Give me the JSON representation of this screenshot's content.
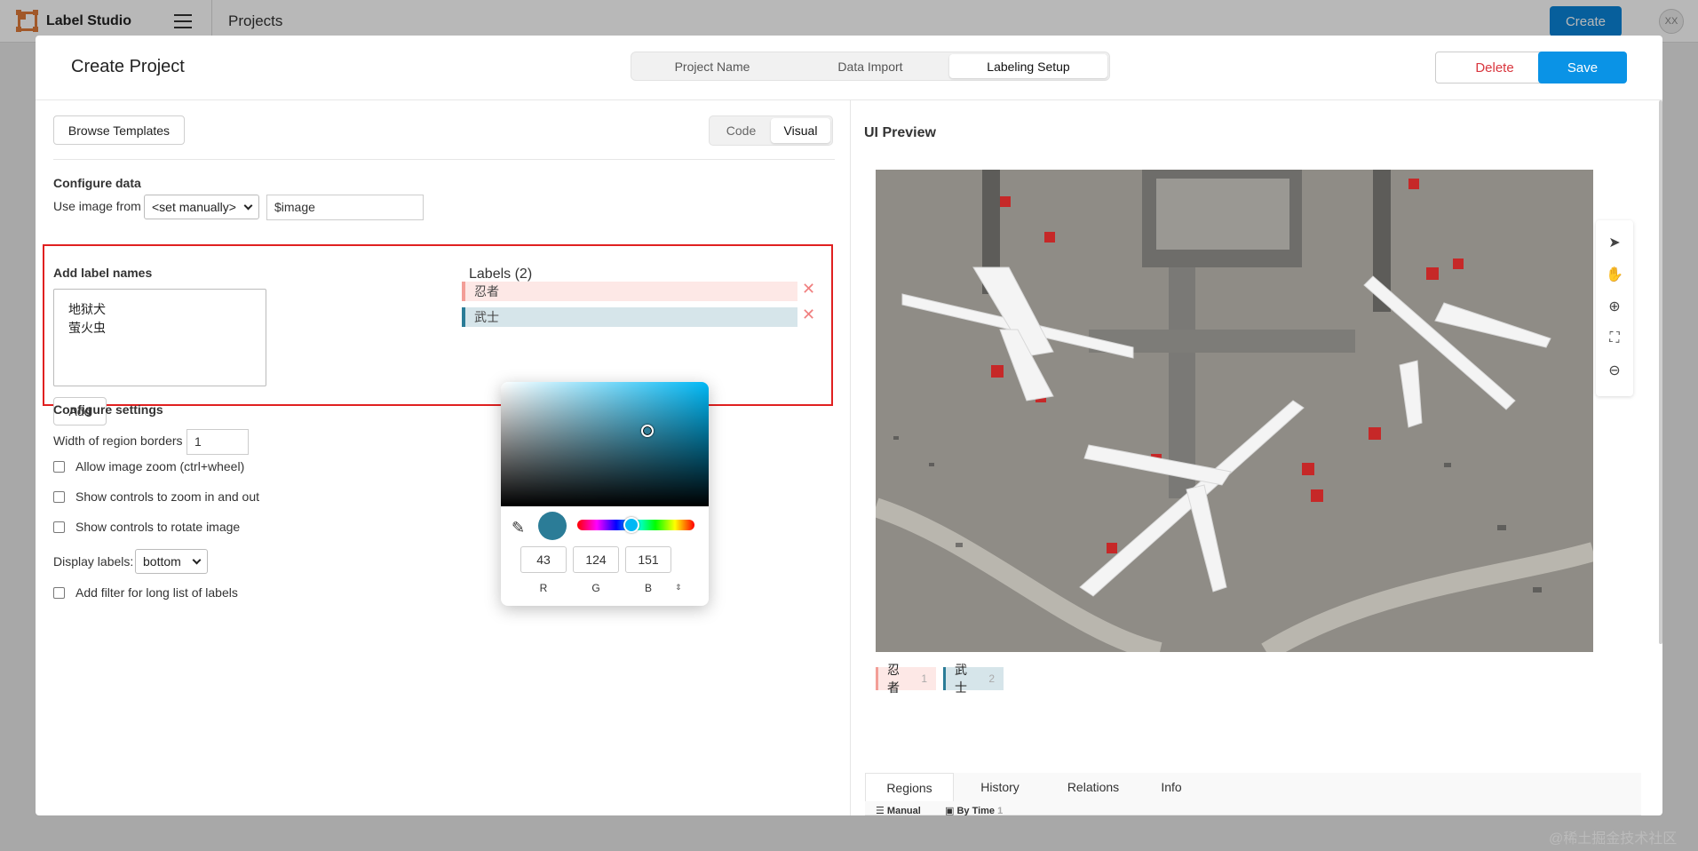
{
  "app": {
    "name": "Label Studio",
    "breadcrumb": "Projects",
    "create_label": "Create",
    "avatar_initials": "XX"
  },
  "modal": {
    "title": "Create Project",
    "steps": [
      "Project Name",
      "Data Import",
      "Labeling Setup"
    ],
    "active_step": "Labeling Setup",
    "delete_label": "Delete",
    "save_label": "Save"
  },
  "config": {
    "browse_templates": "Browse Templates",
    "mode_toggle": {
      "code": "Code",
      "visual": "Visual",
      "active": "Visual"
    },
    "configure_data_title": "Configure data",
    "use_image_from_label": "Use image from",
    "source_select_value": "<set manually>",
    "source_field_value": "$image",
    "add_label_names_title": "Add label names",
    "new_labels_text": [
      "地狱犬",
      "萤火虫"
    ],
    "add_button": "Add",
    "labels_title": "Labels (2)",
    "labels": [
      {
        "name": "忍者",
        "color": "#f39e97"
      },
      {
        "name": "武士",
        "color": "#2b7c97"
      }
    ],
    "configure_settings_title": "Configure settings",
    "region_border_label": "Width of region borders",
    "region_border_value": "1",
    "options": [
      {
        "label": "Allow image zoom (ctrl+wheel)",
        "checked": false
      },
      {
        "label": "Show controls to zoom in and out",
        "checked": false
      },
      {
        "label": "Show controls to rotate image",
        "checked": false
      }
    ],
    "display_labels_label": "Display labels:",
    "display_labels_value": "bottom",
    "filter_option": {
      "label": "Add filter for long list of labels",
      "checked": false
    }
  },
  "color_picker": {
    "current_hex": "#2b7c97",
    "hue_hex": "#00b8f5",
    "r": "43",
    "g": "124",
    "b": "151",
    "r_label": "R",
    "g_label": "G",
    "b_label": "B"
  },
  "preview": {
    "title": "UI Preview",
    "chips": [
      {
        "name": "忍者",
        "hotkey": "1"
      },
      {
        "name": "武士",
        "hotkey": "2"
      }
    ],
    "tools": [
      "pointer-icon",
      "hand-icon",
      "zoom-in-icon",
      "fit-icon",
      "zoom-out-icon"
    ],
    "tabs": [
      "Regions",
      "History",
      "Relations",
      "Info"
    ],
    "active_tab": "Regions",
    "sub_controls": [
      "Manual",
      "By Time",
      "1"
    ]
  },
  "watermark": "@稀土掘金技术社区"
}
